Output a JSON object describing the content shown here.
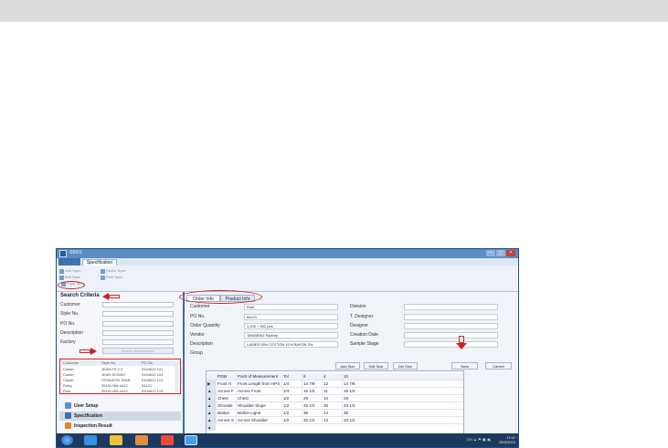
{
  "window": {
    "title": "SBRS",
    "controls": [
      "—",
      "▢",
      "×"
    ]
  },
  "ribbon": {
    "tab": "Specification",
    "buttons": [
      "Add Spec",
      "Delete Spec",
      "Edit Spec",
      "Print Spec",
      "Copy Spec"
    ]
  },
  "search": {
    "title": "Search Criteria",
    "fields": [
      "Customer",
      "Style No.",
      "PO No.",
      "Description",
      "Factory"
    ],
    "button": "Search Specification",
    "results": {
      "columns": [
        "Customer",
        "Style No.",
        "PO No."
      ],
      "rows": [
        [
          "Caster",
          "JEAN FS 2.3",
          "5104612 141"
        ],
        [
          "Caster",
          "JEAN SKINNY",
          "5104612 103"
        ],
        [
          "Caster",
          "STRAIGTH JEAN",
          "5104612 103"
        ],
        [
          "Rubg",
          "35151 NM-4412",
          "54121"
        ],
        [
          "Rubi",
          "35151 NM-4412",
          "5104612 123"
        ]
      ]
    }
  },
  "nav": [
    "User Setup",
    "Specification",
    "Inspection Result"
  ],
  "tabs": [
    "Order Info",
    "Product Info"
  ],
  "order": {
    "left": [
      {
        "label": "Customer",
        "value": "Rubi"
      },
      {
        "label": "PO No.",
        "value": "54121"
      },
      {
        "label": "Order Quantity",
        "value": "1,200 + 502 pcs"
      },
      {
        "label": "Vendor",
        "value": "TANGENG Factory"
      },
      {
        "label": "Description",
        "value": "LADIES 55% COTTON 41% RAYON 2%"
      },
      {
        "label": "Group",
        "value": ""
      }
    ],
    "right": [
      {
        "label": "Division",
        "value": ""
      },
      {
        "label": "T. Designer",
        "value": ""
      },
      {
        "label": "Designer",
        "value": ""
      },
      {
        "label": "Creation Date",
        "value": ""
      },
      {
        "label": "Sample Stage",
        "value": ""
      }
    ]
  },
  "actions": [
    "Add Size",
    "Edit Size",
    "Del Size",
    "Save",
    "Cancel"
  ],
  "measurements": {
    "columns": [
      "POM",
      "Point of Measurement",
      "Tol",
      "8",
      "4",
      "10"
    ],
    "rows": [
      [
        "Front H",
        "Front Length from HPS",
        "1/4",
        "14 7/8",
        "12",
        "14 7/8"
      ],
      [
        "Across F",
        "Across Front",
        "1/4",
        "16 1/4",
        "11",
        "16 1/4"
      ],
      [
        "Chest",
        "Chest",
        "1/2",
        "29",
        "10",
        "29"
      ],
      [
        "Shoulde",
        "Shoulder Slope",
        "1/2",
        "33 1/2",
        "35",
        "33 1/2"
      ],
      [
        "Button",
        "Button Ligne",
        "1/2",
        "35",
        "14",
        "35"
      ],
      [
        "Across S",
        "Across Shoulder",
        "1/2",
        "33 1/2",
        "13",
        "33 1/2"
      ]
    ]
  },
  "taskbar": {
    "tray": "DH  ▲ ⚑ ▣ ◀)",
    "time": "17:47",
    "date": "25/3/2013"
  }
}
